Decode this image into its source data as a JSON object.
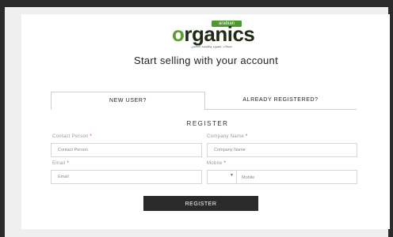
{
  "logo": {
    "ribbon": "arabian",
    "first_letter": "o",
    "rest": "rganics",
    "arabic_caption": "منتجات عضوية وطبيعية العالمي"
  },
  "headline": "Start selling with your account",
  "tabs": [
    {
      "label": "NEW USER?",
      "active": true
    },
    {
      "label": "ALREADY REGISTERED?",
      "active": false
    }
  ],
  "form": {
    "section_title": "REGISTER",
    "contact_person": {
      "label": "Contact Person",
      "placeholder": "Contact Person"
    },
    "company_name": {
      "label": "Company Name",
      "placeholder": "Company Name"
    },
    "email": {
      "label": "Email",
      "placeholder": "Email"
    },
    "mobile": {
      "label": "Mobile",
      "placeholder": "Mobile"
    },
    "required_marker": "*",
    "submit_label": "REGISTER"
  },
  "colors": {
    "brand_green": "#5b9e2f",
    "button_dark": "#2a2a2a",
    "required_red": "#d12b2b"
  }
}
